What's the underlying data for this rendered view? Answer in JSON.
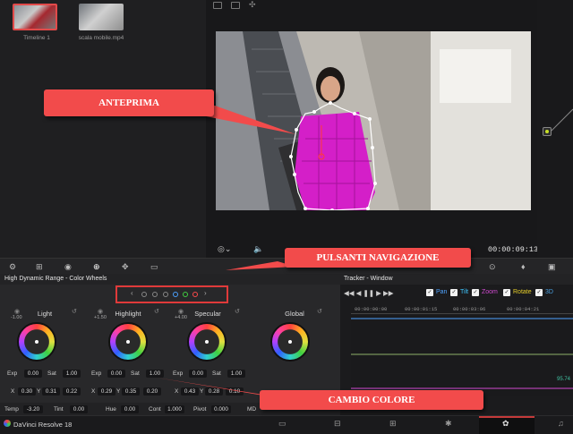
{
  "media_pool": {
    "clips": [
      {
        "label": "Timeline 1"
      },
      {
        "label": "scala mobile.mp4"
      }
    ]
  },
  "viewer": {
    "timecode": "00:00:09:13"
  },
  "annotations": {
    "preview": "ANTEPRIMA",
    "nav_buttons": "PULSANTI NAVIGAZIONE",
    "color_change": "CAMBIO COLORE"
  },
  "color_panel": {
    "title": "High Dynamic Range - Color Wheels",
    "nav_arrows": {
      "prev": "‹",
      "next": "›"
    },
    "wheels": [
      {
        "name": "Light",
        "value": "-1.00",
        "exp": "0.00",
        "sat": "1.00",
        "x": "0.30",
        "y": "0.31",
        "z": "0.22"
      },
      {
        "name": "Highlight",
        "value": "+1.50",
        "exp": "0.00",
        "sat": "1.00",
        "x": "0.29",
        "y": "0.35",
        "z": "0.20"
      },
      {
        "name": "Specular",
        "value": "+4.00",
        "exp": "0.00",
        "sat": "1.00",
        "x": "0.43",
        "y": "0.28",
        "z": "0.10"
      },
      {
        "name": "Global",
        "value": "",
        "exp": "",
        "sat": "",
        "x": "",
        "y": "",
        "z": ""
      }
    ],
    "field_labels": {
      "exp": "Exp",
      "sat": "Sat",
      "x": "X",
      "y": "Y"
    },
    "bottom_row": {
      "temp_label": "Temp",
      "temp": "-3.20",
      "tint_label": "Tint",
      "tint": "0.00",
      "hue_label": "Hue",
      "hue": "0.00",
      "cont_label": "Cont",
      "cont": "1.000",
      "pivot_label": "Pivot",
      "pivot": "0.000",
      "md_label": "MD"
    }
  },
  "tracker": {
    "title": "Tracker - Window",
    "options": [
      {
        "label": "Pan",
        "color": "#4fa3ff"
      },
      {
        "label": "Tilt",
        "color": "#3fc6ff"
      },
      {
        "label": "Zoom",
        "color": "#d04ad0"
      },
      {
        "label": "Rotate",
        "color": "#e8d02a"
      },
      {
        "label": "3D",
        "color": "#4aa0e0"
      }
    ],
    "ruler": [
      "00:00:00:00",
      "00:00:01:15",
      "00:00:03:06",
      "00:00:04:21"
    ],
    "readout": "95.74"
  },
  "status_bar": {
    "app_name": "DaVinci Resolve 18"
  }
}
